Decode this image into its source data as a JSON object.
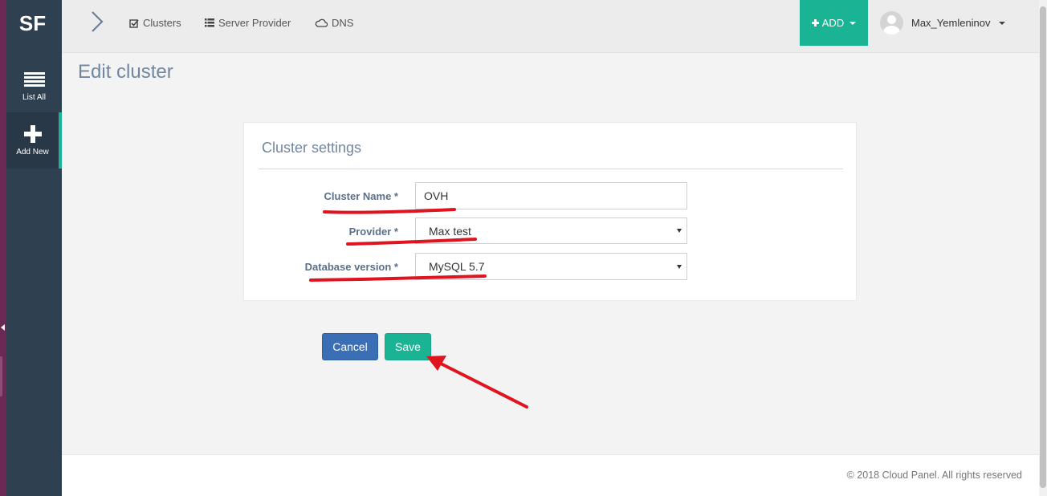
{
  "app": {
    "logo": "SF"
  },
  "sidebar": {
    "items": [
      {
        "label": "List All",
        "icon": "list-icon"
      },
      {
        "label": "Add New",
        "icon": "plus-icon",
        "active": true
      }
    ]
  },
  "topnav": {
    "links": [
      {
        "label": "Clusters",
        "icon": "check-square-icon"
      },
      {
        "label": "Server Provider",
        "icon": "list-icon"
      },
      {
        "label": "DNS",
        "icon": "cloud-icon"
      }
    ],
    "add_label": "ADD",
    "user_name": "Max_Yemleninov"
  },
  "page": {
    "title": "Edit cluster"
  },
  "form": {
    "panel_title": "Cluster settings",
    "cluster_name": {
      "label": "Cluster Name *",
      "value": "OVH"
    },
    "provider": {
      "label": "Provider *",
      "value": "Max test"
    },
    "db_version": {
      "label": "Database version *",
      "value": "MySQL 5.7"
    }
  },
  "actions": {
    "cancel_label": "Cancel",
    "save_label": "Save"
  },
  "footer": {
    "text": "© 2018 Cloud Panel. All rights reserved"
  },
  "colors": {
    "sidebar": "#2f4050",
    "accent": "#1ab394",
    "primary": "#3b6fb5",
    "annotation": "#e0141e"
  }
}
